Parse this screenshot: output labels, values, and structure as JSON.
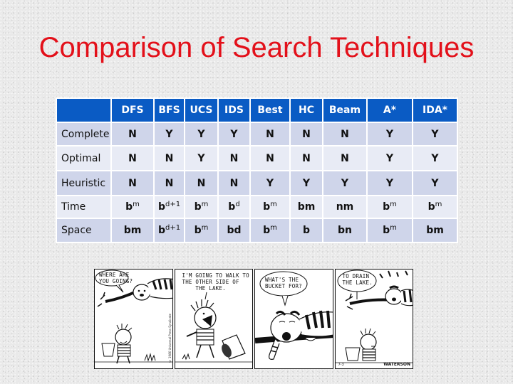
{
  "slide": {
    "title": "Comparison of Search Techniques"
  },
  "table": {
    "corner": "",
    "columns": [
      "DFS",
      "BFS",
      "UCS",
      "IDS",
      "Best",
      "HC",
      "Beam",
      "A*",
      "IDA*"
    ],
    "rows": [
      {
        "label": "Complete",
        "cells": [
          {
            "base": "N",
            "exp": ""
          },
          {
            "base": "Y",
            "exp": ""
          },
          {
            "base": "Y",
            "exp": ""
          },
          {
            "base": "Y",
            "exp": ""
          },
          {
            "base": "N",
            "exp": ""
          },
          {
            "base": "N",
            "exp": ""
          },
          {
            "base": "N",
            "exp": ""
          },
          {
            "base": "Y",
            "exp": ""
          },
          {
            "base": "Y",
            "exp": ""
          }
        ]
      },
      {
        "label": "Optimal",
        "cells": [
          {
            "base": "N",
            "exp": ""
          },
          {
            "base": "N",
            "exp": ""
          },
          {
            "base": "Y",
            "exp": ""
          },
          {
            "base": "N",
            "exp": ""
          },
          {
            "base": "N",
            "exp": ""
          },
          {
            "base": "N",
            "exp": ""
          },
          {
            "base": "N",
            "exp": ""
          },
          {
            "base": "Y",
            "exp": ""
          },
          {
            "base": "Y",
            "exp": ""
          }
        ]
      },
      {
        "label": "Heuristic",
        "cells": [
          {
            "base": "N",
            "exp": ""
          },
          {
            "base": "N",
            "exp": ""
          },
          {
            "base": "N",
            "exp": ""
          },
          {
            "base": "N",
            "exp": ""
          },
          {
            "base": "Y",
            "exp": ""
          },
          {
            "base": "Y",
            "exp": ""
          },
          {
            "base": "Y",
            "exp": ""
          },
          {
            "base": "Y",
            "exp": ""
          },
          {
            "base": "Y",
            "exp": ""
          }
        ]
      },
      {
        "label": "Time",
        "cells": [
          {
            "base": "b",
            "exp": "m"
          },
          {
            "base": "b",
            "exp": "d+1"
          },
          {
            "base": "b",
            "exp": "m"
          },
          {
            "base": "b",
            "exp": "d"
          },
          {
            "base": "b",
            "exp": "m"
          },
          {
            "base": "bm",
            "exp": ""
          },
          {
            "base": "nm",
            "exp": ""
          },
          {
            "base": "b",
            "exp": "m"
          },
          {
            "base": "b",
            "exp": "m"
          }
        ]
      },
      {
        "label": "Space",
        "cells": [
          {
            "base": "bm",
            "exp": ""
          },
          {
            "base": "b",
            "exp": "d+1"
          },
          {
            "base": "b",
            "exp": "m"
          },
          {
            "base": "bd",
            "exp": ""
          },
          {
            "base": "b",
            "exp": "m"
          },
          {
            "base": "b",
            "exp": ""
          },
          {
            "base": "bn",
            "exp": ""
          },
          {
            "base": "b",
            "exp": "m"
          },
          {
            "base": "bm",
            "exp": ""
          }
        ]
      }
    ]
  },
  "comic": {
    "panels": [
      {
        "balloon": "WHERE ARE\nYOU GOING?"
      },
      {
        "balloon": "I'M GOING TO WALK TO\nTHE OTHER SIDE OF\n    THE LAKE."
      },
      {
        "balloon": "WHAT'S THE\nBUCKET FOR?"
      },
      {
        "balloon": "TO DRAIN\nTHE LAKE."
      }
    ],
    "date": "7-3",
    "signature": "WATERSON",
    "copyright": "© 1986 Universal Press Syndicate"
  },
  "colors": {
    "title": "#e3101a",
    "header_bg": "#0a5bc4",
    "row_dark": "#cfd5ea",
    "row_light": "#e8ebf5"
  }
}
